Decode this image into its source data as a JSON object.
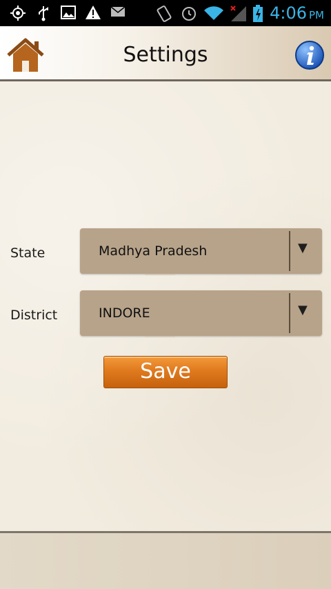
{
  "status_bar": {
    "time": "4:06",
    "ampm": "PM",
    "icons": [
      "gps-icon",
      "usb-icon",
      "image-icon",
      "warning-icon",
      "mail-icon",
      "vibrate-icon",
      "alarm-icon",
      "wifi-icon",
      "signal-icon",
      "battery-icon"
    ]
  },
  "header": {
    "title": "Settings",
    "home_icon": "home-icon",
    "info_icon": "info-icon"
  },
  "form": {
    "state_label": "State",
    "state_value": "Madhya Pradesh",
    "district_label": "District",
    "district_value": "INDORE",
    "dropdown_arrow": "▼",
    "save_label": "Save"
  },
  "colors": {
    "accent": "#3ab5e6",
    "dropdown": "#b7a38a",
    "save": "#e07a1f"
  }
}
